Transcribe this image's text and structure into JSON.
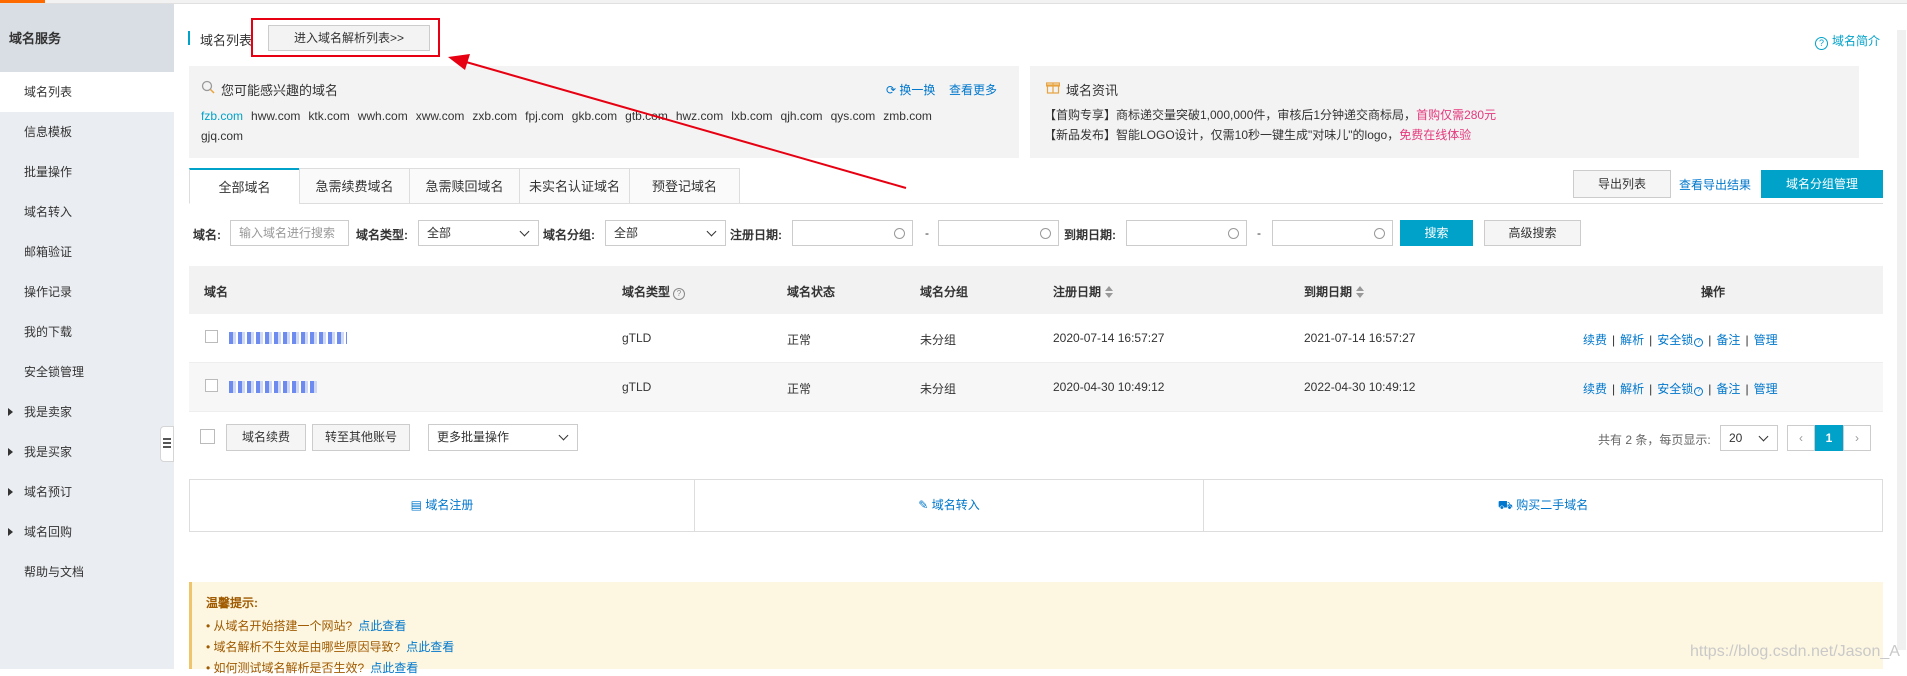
{
  "sidebar": {
    "title": "域名服务",
    "items": [
      {
        "label": "域名列表",
        "active": true,
        "expandable": false
      },
      {
        "label": "信息模板",
        "active": false,
        "expandable": false
      },
      {
        "label": "批量操作",
        "active": false,
        "expandable": false
      },
      {
        "label": "域名转入",
        "active": false,
        "expandable": false
      },
      {
        "label": "邮箱验证",
        "active": false,
        "expandable": false
      },
      {
        "label": "操作记录",
        "active": false,
        "expandable": false
      },
      {
        "label": "我的下载",
        "active": false,
        "expandable": false
      },
      {
        "label": "安全锁管理",
        "active": false,
        "expandable": false
      },
      {
        "label": "我是卖家",
        "active": false,
        "expandable": true
      },
      {
        "label": "我是买家",
        "active": false,
        "expandable": true
      },
      {
        "label": "域名预订",
        "active": false,
        "expandable": true
      },
      {
        "label": "域名回购",
        "active": false,
        "expandable": true
      },
      {
        "label": "帮助与文档",
        "active": false,
        "expandable": false
      }
    ]
  },
  "header": {
    "title": "域名列表",
    "resolve_button": "进入域名解析列表>>",
    "intro_link": "域名简介"
  },
  "interest": {
    "title": "您可能感兴趣的域名",
    "refresh": "换一换",
    "more": "查看更多",
    "domains": [
      "fzb.com",
      "hww.com",
      "ktk.com",
      "wwh.com",
      "xww.com",
      "zxb.com",
      "fpj.com",
      "gkb.com",
      "gtb.com",
      "hwz.com",
      "lxb.com",
      "qjh.com",
      "qys.com",
      "zmb.com",
      "gjq.com"
    ]
  },
  "news": {
    "title": "域名资讯",
    "line1_text": "【首购专享】商标递交量突破1,000,000件，审核后1分钟递交商标局，",
    "line1_link": "首购仅需280元",
    "line2_text": "【新品发布】智能LOGO设计，仅需10秒一键生成\"对味儿\"的logo，",
    "line2_link": "免费在线体验"
  },
  "tabs": [
    "全部域名",
    "急需续费域名",
    "急需赎回域名",
    "未实名认证域名",
    "预登记域名"
  ],
  "actions": {
    "export": "导出列表",
    "export_result": "查看导出结果",
    "group_manage": "域名分组管理"
  },
  "filters": {
    "domain_label": "域名:",
    "domain_placeholder": "输入域名进行搜索",
    "type_label": "域名类型:",
    "type_value": "全部",
    "group_label": "域名分组:",
    "group_value": "全部",
    "reg_label": "注册日期:",
    "exp_label": "到期日期:",
    "dash": "-",
    "search": "搜索",
    "advanced": "高级搜索"
  },
  "table": {
    "headers": [
      "域名",
      "域名类型",
      "域名状态",
      "域名分组",
      "注册日期",
      "到期日期",
      "操作"
    ],
    "rows": [
      {
        "type": "gTLD",
        "status": "正常",
        "group": "未分组",
        "reg": "2020-07-14 16:57:27",
        "exp": "2021-07-14 16:57:27"
      },
      {
        "type": "gTLD",
        "status": "正常",
        "group": "未分组",
        "reg": "2020-04-30 10:49:12",
        "exp": "2022-04-30 10:49:12"
      }
    ],
    "ops": [
      "续费",
      "解析",
      "安全锁",
      "备注",
      "管理"
    ]
  },
  "bulk": {
    "renew": "域名续费",
    "transfer": "转至其他账号",
    "more_ops": "更多批量操作",
    "total": "共有 2 条，每页显示:",
    "page_size": "20",
    "prev": "‹",
    "current_page": "1",
    "next": "›"
  },
  "bottom": {
    "register": "域名注册",
    "transfer_in": "域名转入",
    "buy_second": "购买二手域名"
  },
  "tips": {
    "title": "温馨提示:",
    "items": [
      {
        "text": "• 从域名开始搭建一个网站?",
        "link": "点此查看"
      },
      {
        "text": "• 域名解析不生效是由哪些原因导致?",
        "link": "点此查看"
      },
      {
        "text": "• 如何测试域名解析是否生效?",
        "link": "点此查看"
      }
    ]
  },
  "watermark": "https://blog.csdn.net/Jason_A",
  "colors": {
    "accent": "#00a2ca",
    "link": "#0077cc",
    "annotation": "#e60012",
    "promo": "#e4397d"
  }
}
